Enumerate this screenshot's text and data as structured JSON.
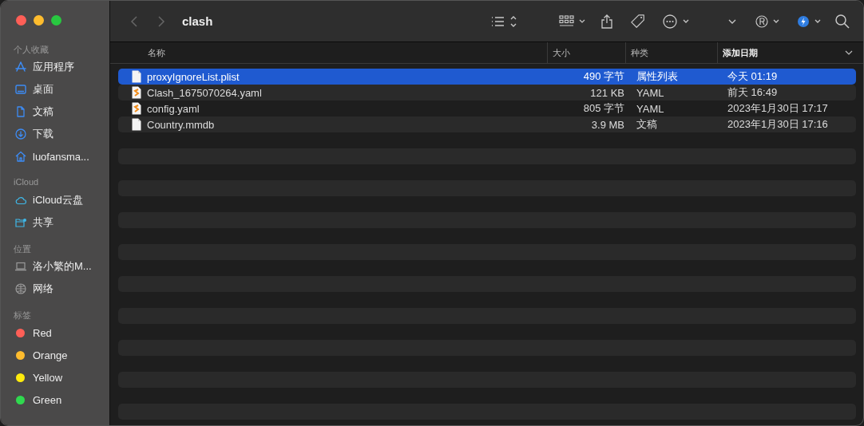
{
  "window": {
    "title": "clash"
  },
  "sidebar": {
    "sections": [
      {
        "heading": "个人收藏",
        "items": [
          {
            "label": "应用程序",
            "kind": "apps"
          },
          {
            "label": "桌面",
            "kind": "desktop"
          },
          {
            "label": "文稿",
            "kind": "document"
          },
          {
            "label": "下载",
            "kind": "download"
          },
          {
            "label": "luofansma...",
            "kind": "home"
          }
        ]
      },
      {
        "heading": "iCloud",
        "items": [
          {
            "label": "iCloud云盘",
            "kind": "cloud"
          },
          {
            "label": "共享",
            "kind": "shared"
          }
        ]
      },
      {
        "heading": "位置",
        "items": [
          {
            "label": "洛小繁的M...",
            "kind": "computer"
          },
          {
            "label": "网络",
            "kind": "network"
          }
        ]
      },
      {
        "heading": "标签",
        "items": [
          {
            "label": "Red",
            "kind": "tag",
            "color": "#ff5f57"
          },
          {
            "label": "Orange",
            "kind": "tag",
            "color": "#febc2e"
          },
          {
            "label": "Yellow",
            "kind": "tag",
            "color": "#ffeb0d"
          },
          {
            "label": "Green",
            "kind": "tag",
            "color": "#30d94f"
          }
        ]
      }
    ]
  },
  "table": {
    "columns": [
      {
        "label": "名称",
        "sorted": false
      },
      {
        "label": "大小",
        "sorted": false
      },
      {
        "label": "种类",
        "sorted": false
      },
      {
        "label": "添加日期",
        "sorted": true
      }
    ],
    "rows": [
      {
        "kind": "plist",
        "name": "proxyIgnoreList.plist",
        "size": "490 字节",
        "type": "属性列表",
        "date": "今天 01:19",
        "selected": true
      },
      {
        "kind": "yaml",
        "name": "Clash_1675070264.yaml",
        "size": "121 KB",
        "type": "YAML",
        "date": "前天 16:49",
        "selected": false
      },
      {
        "kind": "yaml",
        "name": "config.yaml",
        "size": "805 字节",
        "type": "YAML",
        "date": "2023年1月30日 17:17",
        "selected": false
      },
      {
        "kind": "plist",
        "name": "Country.mmdb",
        "size": "3.9 MB",
        "type": "文稿",
        "date": "2023年1月30日 17:16",
        "selected": false
      }
    ]
  }
}
